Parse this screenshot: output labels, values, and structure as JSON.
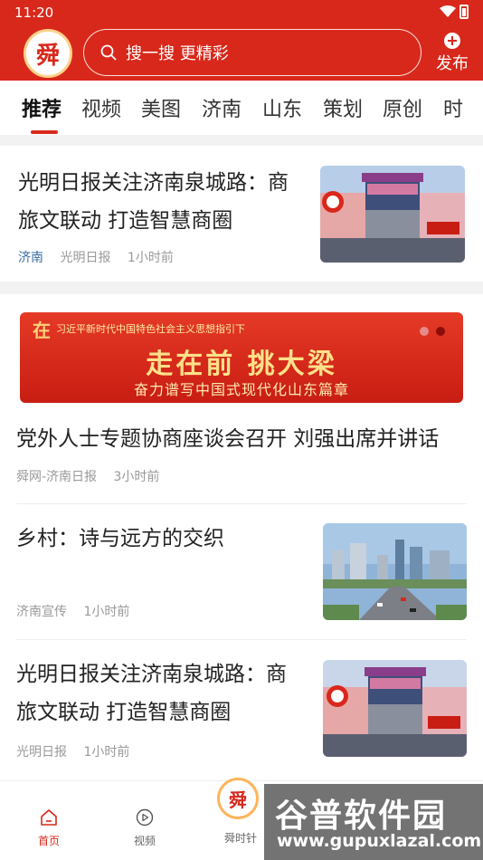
{
  "status": {
    "time": "11:20"
  },
  "header": {
    "logo_text": "舜",
    "search_placeholder": "搜一搜 更精彩",
    "publish_label": "发布"
  },
  "tabs": [
    "推荐",
    "视频",
    "美图",
    "济南",
    "山东",
    "策划",
    "原创",
    "时"
  ],
  "news": [
    {
      "title_line1": "光明日报关注济南泉城路：商",
      "title_line2": "旅文联动 打造智慧商圈",
      "tag": "济南",
      "source": "光明日报",
      "time": "1小时前"
    }
  ],
  "banner": {
    "mark": "在",
    "line1": "习近平新时代中国特色社会主义思想指引下",
    "line2": "走在前 挑大梁",
    "line3": "奋力谱写中国式现代化山东篇章",
    "dot_active_color": "#e78a8a",
    "dot_inactive_color": "#8b0d09"
  },
  "feed": [
    {
      "title": "党外人士专题协商座谈会召开 刘强出席并讲话",
      "source": "舜网-济南日报",
      "time": "3小时前"
    },
    {
      "title": "乡村：诗与远方的交织",
      "source": "济南宣传",
      "time": "1小时前"
    },
    {
      "title_line1": "光明日报关注济南泉城路：商",
      "title_line2": "旅文联动 打造智慧商圈",
      "source": "光明日报",
      "time": "1小时前"
    }
  ],
  "bottom_nav": [
    {
      "label": "首页",
      "icon": "home-icon",
      "active": true
    },
    {
      "label": "视频",
      "icon": "video-icon"
    },
    {
      "label": "舜时针",
      "icon": "logo"
    }
  ],
  "watermark": {
    "line1": "谷普软件园",
    "line2": "www.gupuxlazal.com"
  },
  "colors": {
    "brand": "#d8281b",
    "tag": "#3a6ea5"
  }
}
